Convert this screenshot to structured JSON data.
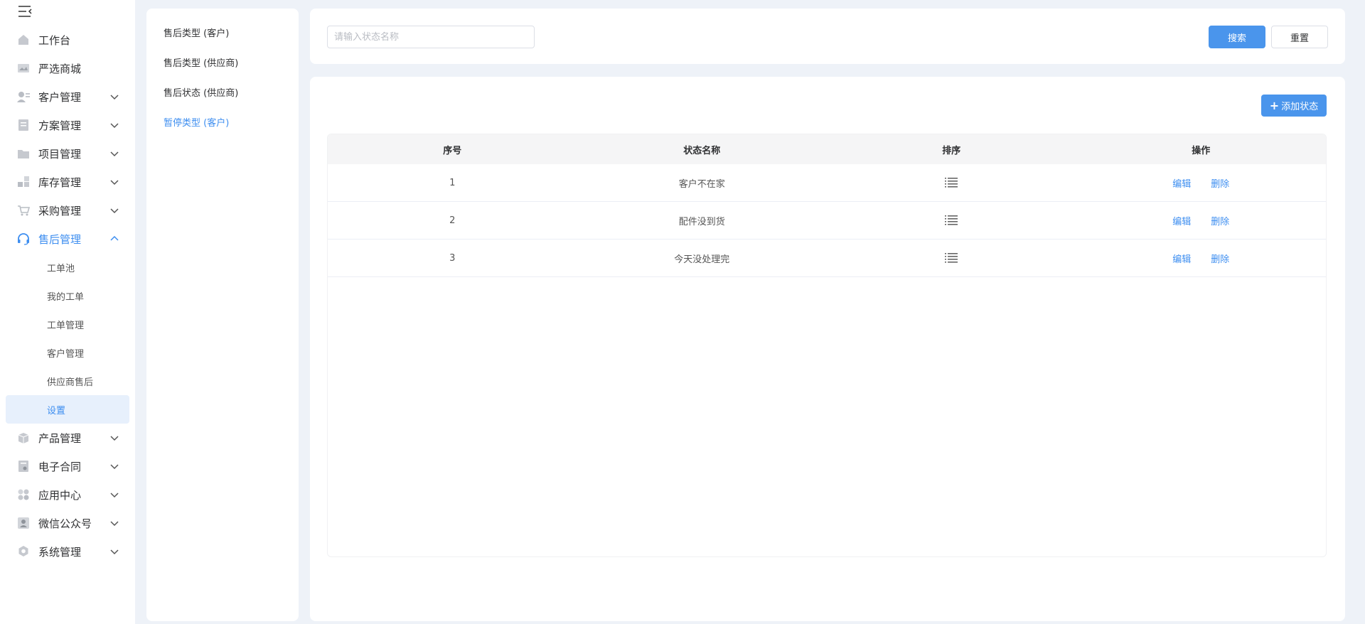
{
  "sidebar": {
    "items": [
      {
        "label": "工作台",
        "icon": "home-icon",
        "chevron": false
      },
      {
        "label": "严选商城",
        "icon": "image-icon",
        "chevron": false
      },
      {
        "label": "客户管理",
        "icon": "user-card-icon",
        "chevron": true
      },
      {
        "label": "方案管理",
        "icon": "document-icon",
        "chevron": true
      },
      {
        "label": "项目管理",
        "icon": "folder-icon",
        "chevron": true
      },
      {
        "label": "库存管理",
        "icon": "blocks-icon",
        "chevron": true
      },
      {
        "label": "采购管理",
        "icon": "cart-icon",
        "chevron": true
      },
      {
        "label": "售后管理",
        "icon": "headset-icon",
        "chevron": true,
        "expanded": true
      },
      {
        "label": "产品管理",
        "icon": "box-icon",
        "chevron": true
      },
      {
        "label": "电子合同",
        "icon": "contract-icon",
        "chevron": true
      },
      {
        "label": "应用中心",
        "icon": "apps-icon",
        "chevron": true
      },
      {
        "label": "微信公众号",
        "icon": "person-icon",
        "chevron": true
      },
      {
        "label": "系统管理",
        "icon": "gear-icon",
        "chevron": true
      }
    ],
    "submenu": [
      "工单池",
      "我的工单",
      "工单管理",
      "客户管理",
      "供应商售后",
      "设置"
    ],
    "selected_submenu": "设置"
  },
  "categories": [
    {
      "label": "售后类型 (客户)",
      "active": false
    },
    {
      "label": "售后类型 (供应商)",
      "active": false
    },
    {
      "label": "售后状态 (供应商)",
      "active": false
    },
    {
      "label": "暂停类型 (客户)",
      "active": true
    }
  ],
  "search": {
    "placeholder": "请输入状态名称",
    "value": "",
    "search_label": "搜索",
    "reset_label": "重置"
  },
  "toolbar": {
    "add_label": "添加状态"
  },
  "table": {
    "headers": [
      "序号",
      "状态名称",
      "排序",
      "操作"
    ],
    "rows": [
      {
        "index": "1",
        "name": "客户不在家",
        "edit": "编辑",
        "delete": "删除"
      },
      {
        "index": "2",
        "name": "配件没到货",
        "edit": "编辑",
        "delete": "删除"
      },
      {
        "index": "3",
        "name": "今天没处理完",
        "edit": "编辑",
        "delete": "删除"
      }
    ]
  },
  "colors": {
    "accent": "#3d8ef0",
    "primary_button": "#4a95ec",
    "page_background": "#eef2f8",
    "table_header": "#f5f5f6",
    "selected_submenu_bg": "#e7f0fc"
  }
}
